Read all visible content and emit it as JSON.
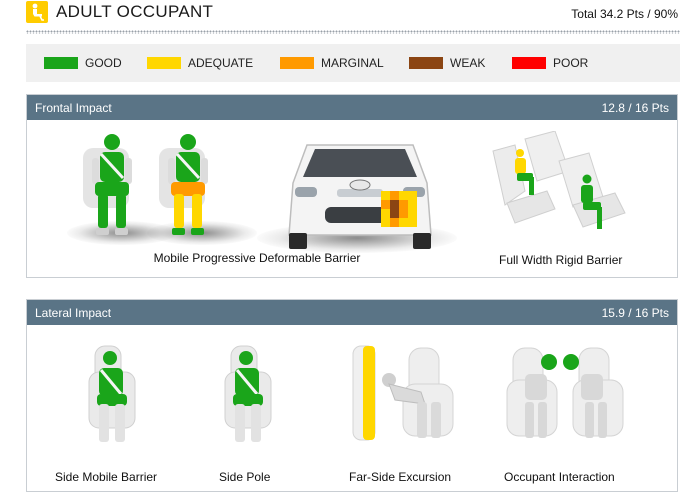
{
  "header": {
    "title": "ADULT OCCUPANT",
    "total": "Total 34.2 Pts / 90%",
    "icon": "seated-occupant-icon",
    "accent_color": "#ffcc00"
  },
  "legend": [
    {
      "label": "GOOD",
      "color": "#1aa51a"
    },
    {
      "label": "ADEQUATE",
      "color": "#ffd700"
    },
    {
      "label": "MARGINAL",
      "color": "#ff9a00"
    },
    {
      "label": "WEAK",
      "color": "#8b4513"
    },
    {
      "label": "POOR",
      "color": "#ff0000"
    }
  ],
  "frontal": {
    "title": "Frontal Impact",
    "score": "12.8 / 16 Pts",
    "tests": [
      {
        "caption": "Mobile Progressive Deformable Barrier"
      },
      {
        "caption": "Full Width Rigid Barrier"
      }
    ]
  },
  "lateral": {
    "title": "Lateral Impact",
    "score": "15.9 / 16 Pts",
    "tests": [
      {
        "caption": "Side Mobile Barrier"
      },
      {
        "caption": "Side Pole"
      },
      {
        "caption": "Far-Side Excursion"
      },
      {
        "caption": "Occupant Interaction"
      }
    ]
  }
}
